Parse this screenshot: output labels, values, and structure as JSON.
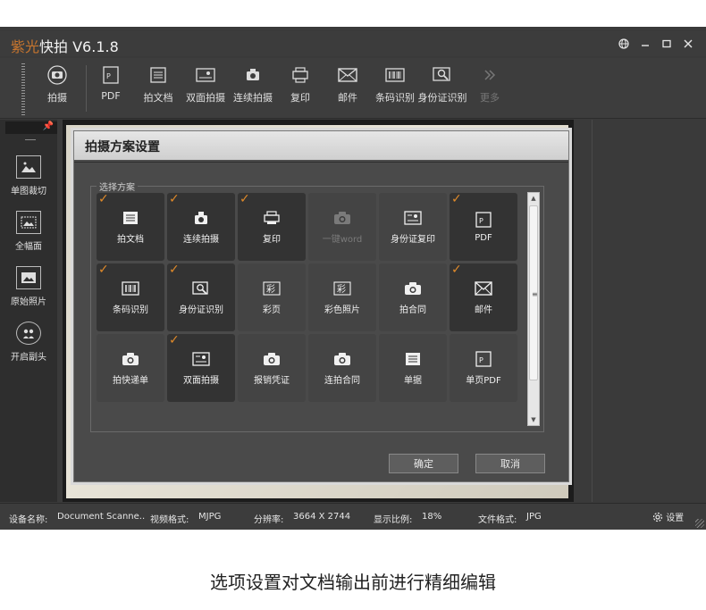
{
  "app": {
    "brand_part1": "紫光",
    "brand_part2": "快拍 V6.1.8",
    "window_controls": [
      "globe-icon",
      "minimize-icon",
      "maximize-icon",
      "close-icon"
    ]
  },
  "toolbar": {
    "items": [
      {
        "label": "拍摄",
        "icon": "camera-icon"
      },
      {
        "label": "PDF",
        "icon": "pdf-icon"
      },
      {
        "label": "拍文档",
        "icon": "document-icon"
      },
      {
        "label": "双面拍摄",
        "icon": "duplex-icon"
      },
      {
        "label": "连续拍摄",
        "icon": "continuous-camera-icon"
      },
      {
        "label": "复印",
        "icon": "copy-icon"
      },
      {
        "label": "邮件",
        "icon": "mail-icon"
      },
      {
        "label": "条码识别",
        "icon": "barcode-icon"
      },
      {
        "label": "身份证识别",
        "icon": "id-card-icon"
      },
      {
        "label": "更多",
        "icon": "chevron-double-right-icon"
      }
    ]
  },
  "left_panel": {
    "items": [
      {
        "label": "单图裁切",
        "icon": "crop-image-icon"
      },
      {
        "label": "全幅面",
        "icon": "full-frame-icon"
      },
      {
        "label": "原始照片",
        "icon": "original-photo-icon"
      },
      {
        "label": "开启副头",
        "icon": "secondary-camera-icon"
      }
    ]
  },
  "dialog": {
    "title": "拍摄方案设置",
    "group_label": "选择方案",
    "cells": [
      {
        "label": "拍文档",
        "icon": "document-icon",
        "checked": true,
        "disabled": false
      },
      {
        "label": "连续拍摄",
        "icon": "continuous-camera-icon",
        "checked": true,
        "disabled": false
      },
      {
        "label": "复印",
        "icon": "copy-icon",
        "checked": true,
        "disabled": false
      },
      {
        "label": "一键word",
        "icon": "camera-icon",
        "checked": false,
        "disabled": true
      },
      {
        "label": "身份证复印",
        "icon": "id-card-copy-icon",
        "checked": false,
        "disabled": false
      },
      {
        "label": "PDF",
        "icon": "pdf-icon",
        "checked": true,
        "disabled": false
      },
      {
        "label": "条码识别",
        "icon": "barcode-icon",
        "checked": true,
        "disabled": false
      },
      {
        "label": "身份证识别",
        "icon": "id-card-icon",
        "checked": true,
        "disabled": false
      },
      {
        "label": "彩页",
        "icon": "color-page-icon",
        "checked": false,
        "disabled": false
      },
      {
        "label": "彩色照片",
        "icon": "color-photo-icon",
        "checked": false,
        "disabled": false
      },
      {
        "label": "拍合同",
        "icon": "camera-icon",
        "checked": false,
        "disabled": false
      },
      {
        "label": "邮件",
        "icon": "mail-icon",
        "checked": true,
        "disabled": false
      },
      {
        "label": "拍快递单",
        "icon": "camera-icon",
        "checked": false,
        "disabled": false
      },
      {
        "label": "双面拍摄",
        "icon": "duplex-icon",
        "checked": true,
        "disabled": false
      },
      {
        "label": "报销凭证",
        "icon": "camera-icon",
        "checked": false,
        "disabled": false
      },
      {
        "label": "连拍合同",
        "icon": "camera-icon",
        "checked": false,
        "disabled": false
      },
      {
        "label": "单据",
        "icon": "document-icon",
        "checked": false,
        "disabled": false
      },
      {
        "label": "单页PDF",
        "icon": "pdf-icon",
        "checked": false,
        "disabled": false
      }
    ],
    "ok_label": "确定",
    "cancel_label": "取消"
  },
  "statusbar": {
    "device_label": "设备名称:",
    "device_value": "Document Scanne..",
    "video_label": "视频格式:",
    "video_value": "MJPG",
    "resolution_label": "分辨率:",
    "resolution_value": "3664 X 2744",
    "ratio_label": "显示比例:",
    "ratio_value": "18%",
    "format_label": "文件格式:",
    "format_value": "JPG",
    "settings_label": "设置"
  },
  "caption": "选项设置对文档输出前进行精细编辑",
  "colors": {
    "accent": "#e08a2a",
    "brand": "#c7752e",
    "background": "#3a3a3a"
  }
}
